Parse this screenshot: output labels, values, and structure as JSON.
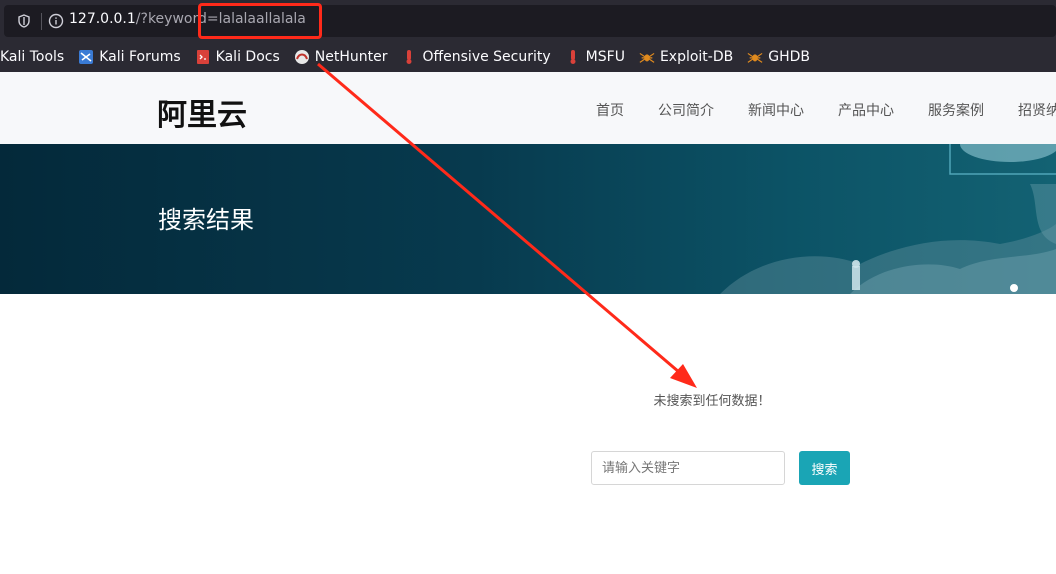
{
  "browser": {
    "url_host": "127.0.0.1",
    "url_path": "/?keyword",
    "url_value": "=lalalaallalala",
    "bookmarks": [
      {
        "label": "Kali Tools",
        "icon": "none"
      },
      {
        "label": "Kali Forums",
        "icon": "kali-forums-icon"
      },
      {
        "label": "Kali Docs",
        "icon": "kali-docs-icon"
      },
      {
        "label": "NetHunter",
        "icon": "nethunter-icon"
      },
      {
        "label": "Offensive Security",
        "icon": "offsec-icon"
      },
      {
        "label": "MSFU",
        "icon": "msfu-icon"
      },
      {
        "label": "Exploit-DB",
        "icon": "exploit-db-icon"
      },
      {
        "label": "GHDB",
        "icon": "ghdb-icon"
      }
    ]
  },
  "site": {
    "logo": "阿里云",
    "nav": [
      "首页",
      "公司简介",
      "新闻中心",
      "产品中心",
      "服务案例",
      "招贤纳"
    ]
  },
  "banner": {
    "title": "搜索结果"
  },
  "results": {
    "empty_message": "未搜索到任何数据！"
  },
  "search": {
    "placeholder": "请输入关键字",
    "button_label": "搜索"
  },
  "colors": {
    "accent": "#1aa5b5",
    "annotation_red": "#ff2a1a",
    "banner_dark": "#04293a"
  }
}
